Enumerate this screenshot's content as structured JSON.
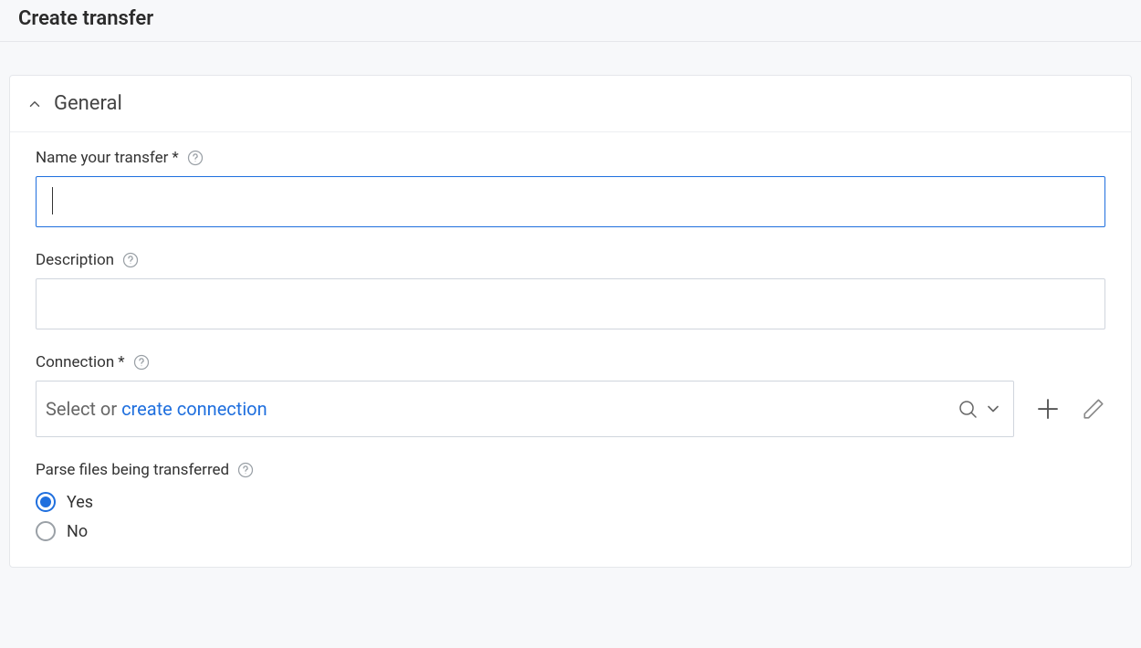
{
  "header": {
    "title": "Create transfer"
  },
  "section": {
    "general": {
      "title": "General"
    }
  },
  "fields": {
    "name": {
      "label": "Name your transfer",
      "required": "*",
      "value": ""
    },
    "description": {
      "label": "Description",
      "value": ""
    },
    "connection": {
      "label": "Connection",
      "required": "*",
      "placeholder_prefix": "Select or ",
      "placeholder_link": "create connection",
      "value": ""
    },
    "parse": {
      "label": "Parse files being transferred",
      "options": {
        "yes": "Yes",
        "no": "No"
      },
      "selected": "yes"
    }
  }
}
